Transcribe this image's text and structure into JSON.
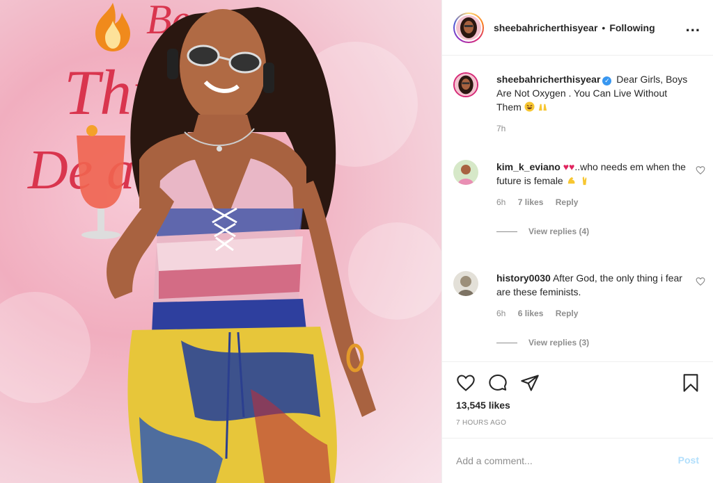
{
  "post": {
    "banner_line1": "Bess",
    "banner_line2": "Thr  ior",
    "banner_line3": "De      arty"
  },
  "header": {
    "username": "sheebahricherthisyear",
    "separator": "•",
    "follow_label": "Following",
    "more_label": "..."
  },
  "caption": {
    "username": "sheebahricherthisyear",
    "verified_mark": "✓",
    "text": "Dear Girls, Boys Are Not Oxygen . You Can Live Without Them",
    "time": "7h"
  },
  "comments": [
    {
      "username": "kim_k_eviano",
      "text_before": "..who needs em when the future is female",
      "time": "6h",
      "likes": "7 likes",
      "reply": "Reply",
      "view_replies": "View replies (4)"
    },
    {
      "username": "history0030",
      "text": "After God, the only thing i fear are these feminists.",
      "time": "6h",
      "likes": "6 likes",
      "reply": "Reply",
      "view_replies": "View replies (3)"
    }
  ],
  "actions": {
    "likes": "13,545 likes",
    "posted_ago": "7 HOURS AGO"
  },
  "add_comment": {
    "placeholder": "Add a comment...",
    "post_label": "Post"
  },
  "colors": {
    "brand_blue": "#3897f0",
    "post_disabled": "#b2dffc",
    "muted": "#8e8e8e",
    "banner_red": "#d9354e"
  },
  "icons": [
    "heart-icon",
    "comment-icon",
    "share-icon",
    "bookmark-icon",
    "verified-icon",
    "more-icon"
  ]
}
